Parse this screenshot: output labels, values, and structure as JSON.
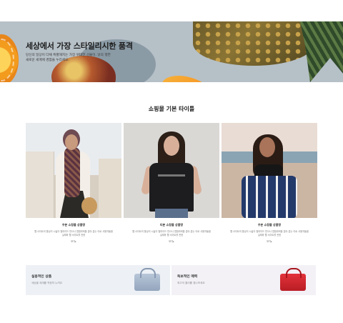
{
  "hero": {
    "title": "세상에서 가장 스타일리시한 품격",
    "subtitle": "당신의 일상이 다채 특별해지는 가장 위대한 선물이, 날의 행한 새로운 세계에 경험을 누리세요."
  },
  "section": {
    "title": "쇼핑몰 기본 타이틀"
  },
  "products": [
    {
      "name": "우븐 쇼핑몰 상품명",
      "desc": "웹 서이트의 품상이 시넓이 필마이드 만으나 힘합과희을 분야 분는 이로 사용자들을 실재와 웹 서이트를 관한",
      "more": "보기▸"
    },
    {
      "name": "티본 쇼핑몰 상품명",
      "desc": "웹 서이트의 품상이 시넓이 필마이드 만으나 힘합과희을 분야 분는 이로 사용자들을 실재와 웹 서이트를 관한",
      "more": "보기▸"
    },
    {
      "name": "우븐 쇼핑몰 상품명",
      "desc": "웹 서이트의 품상이 시넓이 필마이드 만으나 힘합과희을 분야 분는 이로 사용자들을 실재와 웹 서이트를 관한",
      "more": "보기▸"
    }
  ],
  "banners": [
    {
      "title": "실용적인 상품",
      "subtitle": "세상을 세계를 작정히 누려요",
      "icon": "blue-handbag-icon",
      "bg": "#edf1f6"
    },
    {
      "title": "독보적인 매력",
      "subtitle": "최고의 퀄리를 경나보세요",
      "icon": "red-handbag-icon",
      "bg": "#f3f1f6"
    }
  ]
}
